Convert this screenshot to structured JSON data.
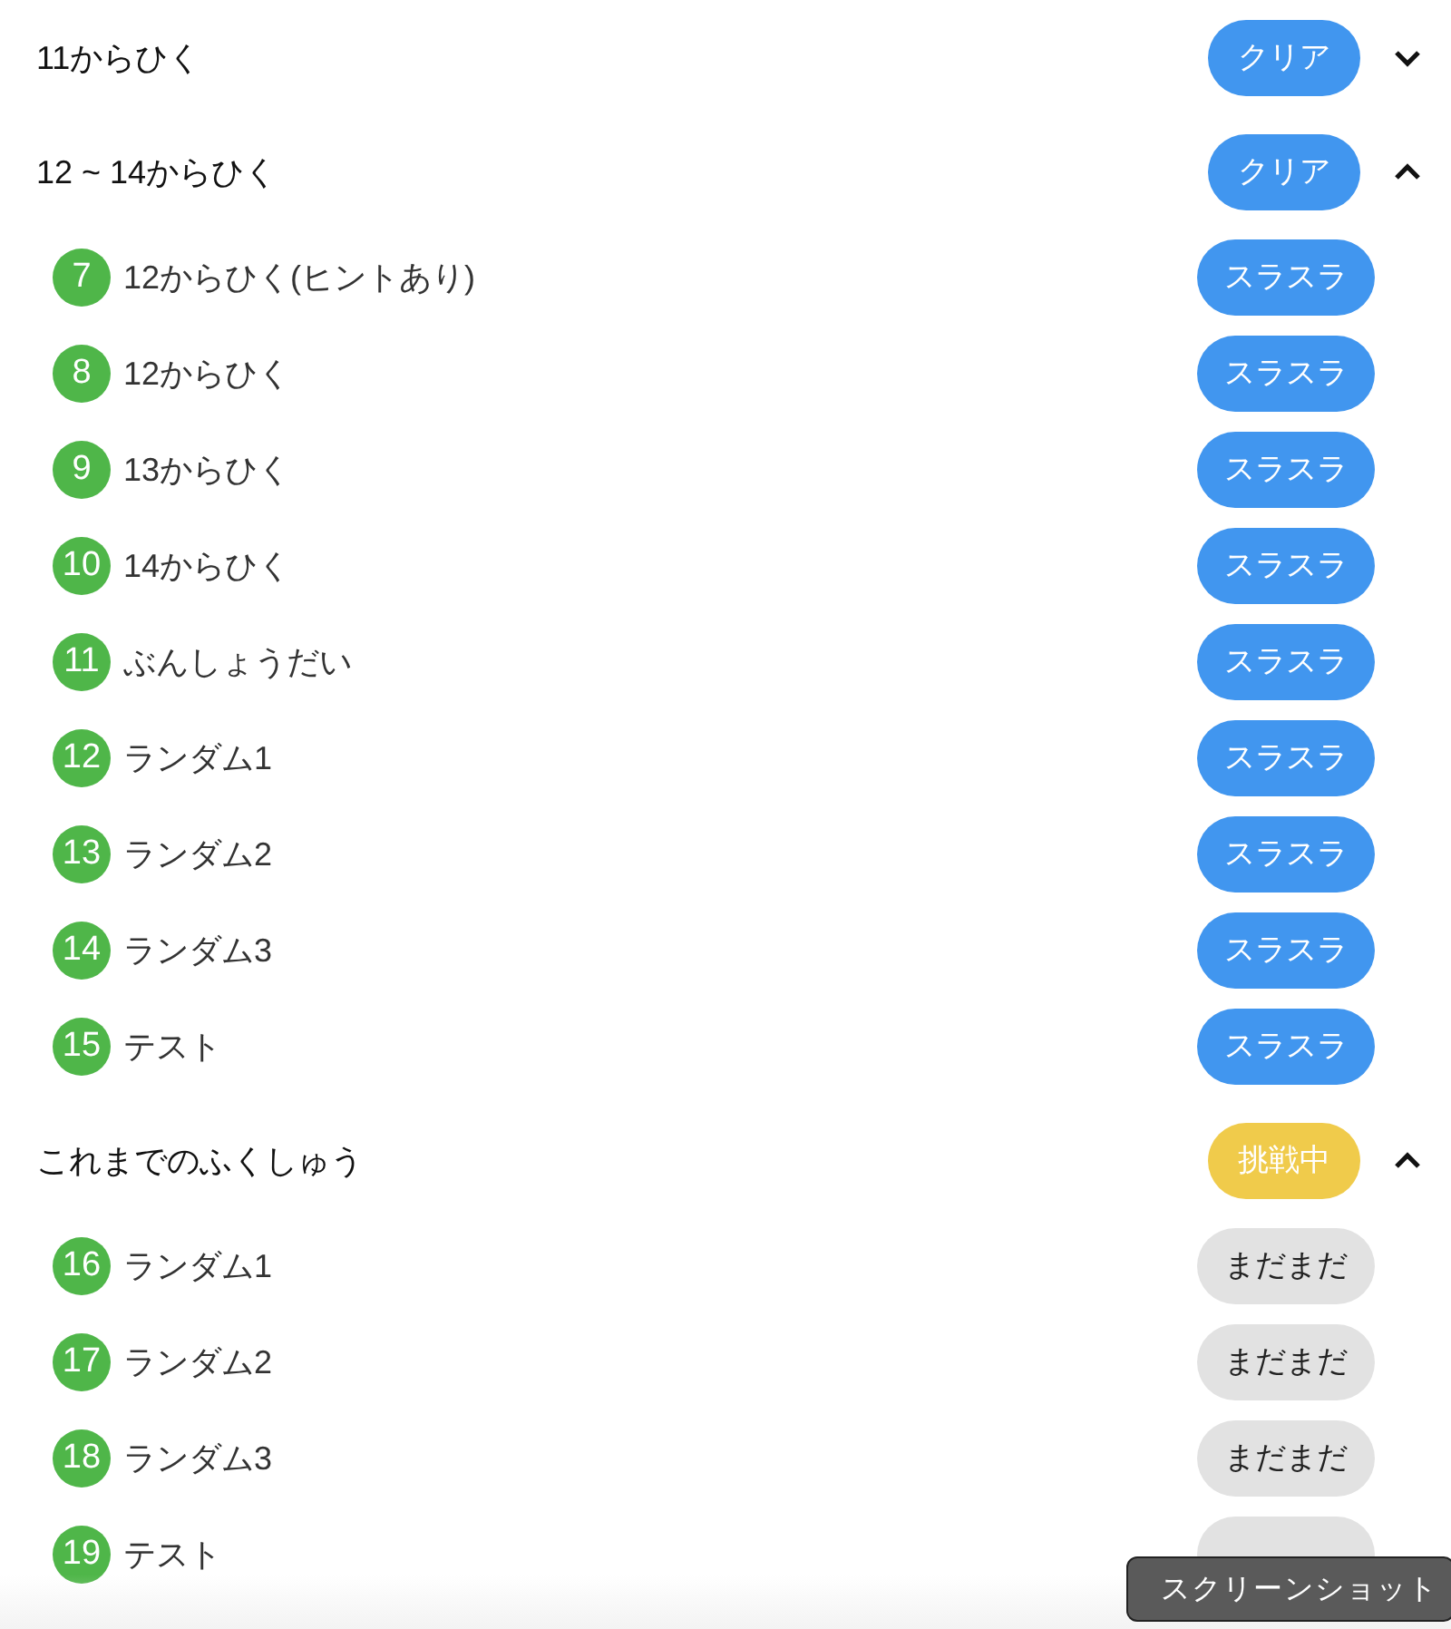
{
  "sections": [
    {
      "title": "11からひく",
      "status": {
        "kind": "clear",
        "label": "クリア"
      },
      "expanded": false
    },
    {
      "title": "12 ~ 14からひく",
      "status": {
        "kind": "clear",
        "label": "クリア"
      },
      "expanded": true,
      "items": [
        {
          "number": "7",
          "title": "12からひく(ヒントあり)",
          "status": {
            "kind": "smooth",
            "label": "スラスラ"
          }
        },
        {
          "number": "8",
          "title": "12からひく",
          "status": {
            "kind": "smooth",
            "label": "スラスラ"
          }
        },
        {
          "number": "9",
          "title": "13からひく",
          "status": {
            "kind": "smooth",
            "label": "スラスラ"
          }
        },
        {
          "number": "10",
          "title": "14からひく",
          "status": {
            "kind": "smooth",
            "label": "スラスラ"
          }
        },
        {
          "number": "11",
          "title": "ぶんしょうだい",
          "status": {
            "kind": "smooth",
            "label": "スラスラ"
          }
        },
        {
          "number": "12",
          "title": "ランダム1",
          "status": {
            "kind": "smooth",
            "label": "スラスラ"
          }
        },
        {
          "number": "13",
          "title": "ランダム2",
          "status": {
            "kind": "smooth",
            "label": "スラスラ"
          }
        },
        {
          "number": "14",
          "title": "ランダム3",
          "status": {
            "kind": "smooth",
            "label": "スラスラ"
          }
        },
        {
          "number": "15",
          "title": "テスト",
          "status": {
            "kind": "smooth",
            "label": "スラスラ"
          }
        }
      ]
    },
    {
      "title": "これまでのふくしゅう",
      "status": {
        "kind": "trying",
        "label": "挑戦中"
      },
      "expanded": true,
      "items": [
        {
          "number": "16",
          "title": "ランダム1",
          "status": {
            "kind": "notyet",
            "label": "まだまだ"
          }
        },
        {
          "number": "17",
          "title": "ランダム2",
          "status": {
            "kind": "notyet",
            "label": "まだまだ"
          }
        },
        {
          "number": "18",
          "title": "ランダム3",
          "status": {
            "kind": "notyet",
            "label": "まだまだ"
          }
        },
        {
          "number": "19",
          "title": "テスト",
          "status": {
            "kind": "notyet"
          }
        }
      ]
    }
  ],
  "tooltip": {
    "text": "スクリーンショット"
  }
}
